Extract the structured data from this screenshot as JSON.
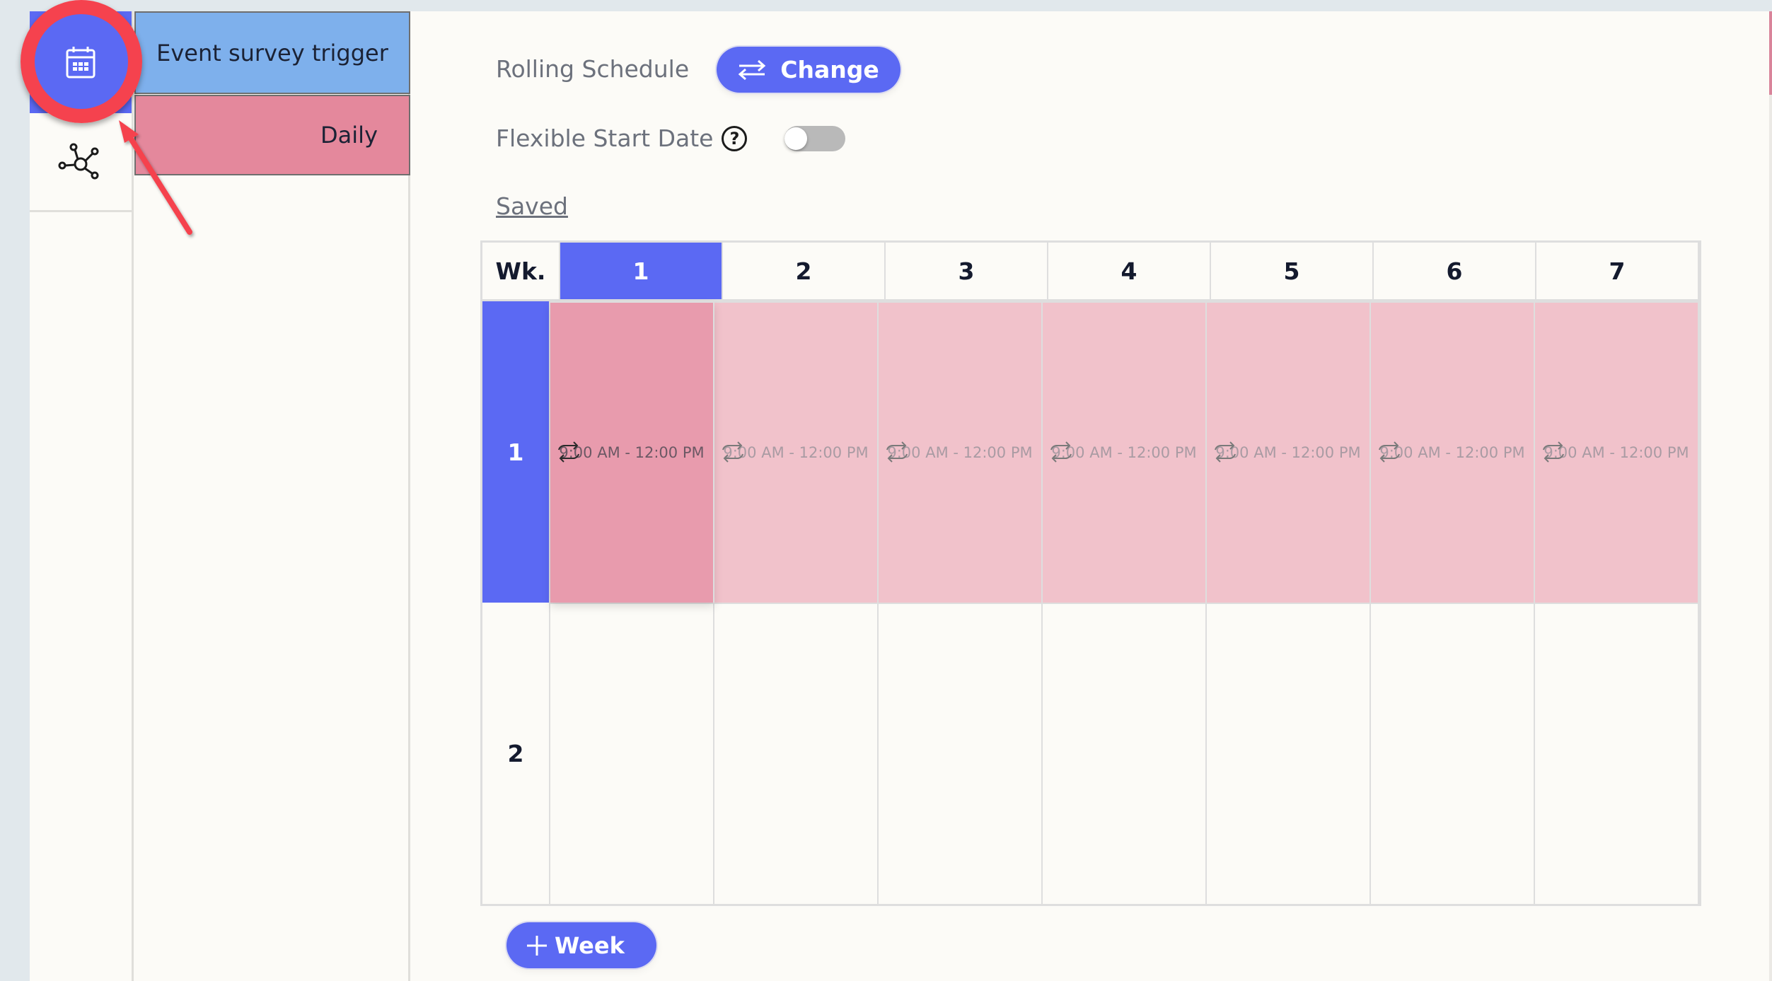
{
  "icon_nav": {
    "items": [
      {
        "name": "calendar",
        "icon": "calendar-icon",
        "active": true
      },
      {
        "name": "network",
        "icon": "network-nodes-icon",
        "active": false
      }
    ]
  },
  "sub_sidebar": {
    "items": [
      {
        "label": "Event survey trigger",
        "color": "#7eb0ec"
      },
      {
        "label": "Daily",
        "color": "#e4889c"
      }
    ]
  },
  "schedule_settings": {
    "rolling_label": "Rolling Schedule",
    "change_button": "Change",
    "flexible_label": "Flexible Start Date",
    "help_glyph": "?",
    "flexible_enabled": false,
    "saved_label": "Saved"
  },
  "table": {
    "corner_label": "Wk.",
    "days": [
      "1",
      "2",
      "3",
      "4",
      "5",
      "6",
      "7"
    ],
    "active_day": "1",
    "weeks": [
      {
        "label": "1",
        "active": true,
        "cells": [
          "9:00 AM - 12:00 PM",
          "9:00 AM - 12:00 PM",
          "9:00 AM - 12:00 PM",
          "9:00 AM - 12:00 PM",
          "9:00 AM - 12:00 PM",
          "9:00 AM - 12:00 PM",
          "9:00 AM - 12:00 PM"
        ]
      },
      {
        "label": "2",
        "active": false,
        "cells": [
          "",
          "",
          "",
          "",
          "",
          "",
          ""
        ]
      }
    ]
  },
  "add_week_button": {
    "icon": "plus-icon",
    "label": "Week"
  },
  "colors": {
    "accent": "#5b69f3",
    "trigger_blue": "#7eb0ec",
    "daily_pink": "#e4889c",
    "cell_pink": "#f1c2cb",
    "cell_pink_active": "#e89bad",
    "annotation_red": "#f5424e"
  }
}
